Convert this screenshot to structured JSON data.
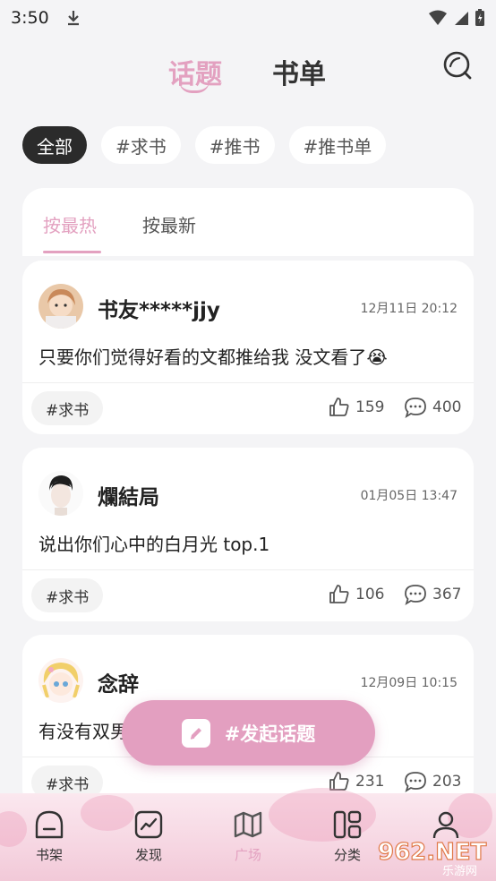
{
  "status_bar": {
    "time": "3:50"
  },
  "header": {
    "tab_topic": "话题",
    "tab_booklist": "书单"
  },
  "chips": [
    "全部",
    "#求书",
    "#推书",
    "#推书单"
  ],
  "sort": {
    "hot": "按最热",
    "new": "按最新"
  },
  "posts": [
    {
      "author": "书友*****jjy",
      "time": "12月11日 20:12",
      "content": "只要你们觉得好看的文都推给我 没文看了😭",
      "tag": "#求书",
      "likes": "159",
      "comments": "400"
    },
    {
      "author": "爛結局",
      "time": "01月05日 13:47",
      "content": "说出你们心中的白月光 top.1",
      "tag": "#求书",
      "likes": "106",
      "comments": "367"
    },
    {
      "author": "念辞",
      "time": "12月09日 10:15",
      "content": "有没有双男",
      "tag": "#求书",
      "likes": "231",
      "comments": "203"
    }
  ],
  "fab": {
    "label": "#发起话题"
  },
  "nav": [
    {
      "label": "书架",
      "icon": "bookshelf-icon"
    },
    {
      "label": "发现",
      "icon": "trend-icon"
    },
    {
      "label": "广场",
      "icon": "map-icon"
    },
    {
      "label": "分类",
      "icon": "category-icon"
    },
    {
      "label": "",
      "icon": "profile-icon"
    }
  ],
  "watermark": {
    "text": "962.NET",
    "sub": "乐游网"
  },
  "colors": {
    "accent": "#e3a1c0",
    "chip_active": "#2b2b2b",
    "fab": "#e39fc0"
  }
}
